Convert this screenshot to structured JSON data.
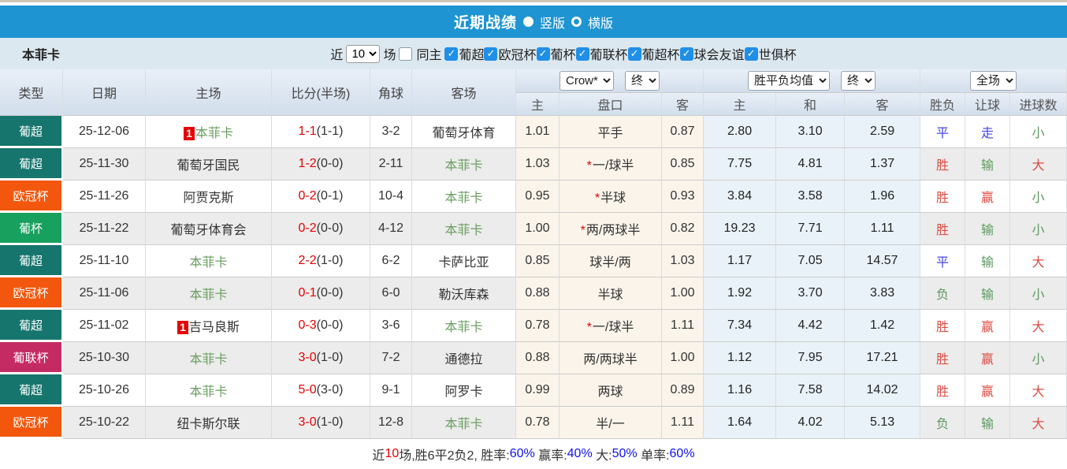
{
  "top_bar": {
    "title": "近期战绩",
    "view_options": [
      {
        "label": "竖版",
        "selected": true
      },
      {
        "label": "横版",
        "selected": false
      }
    ]
  },
  "filter": {
    "team_name": "本菲卡",
    "recent_label": "近",
    "recent_count": "10",
    "matches_label": "场",
    "same_home": {
      "label": "同主",
      "checked": false
    },
    "leagues": [
      {
        "label": "葡超",
        "checked": true
      },
      {
        "label": "欧冠杯",
        "checked": true
      },
      {
        "label": "葡杯",
        "checked": true
      },
      {
        "label": "葡联杯",
        "checked": true
      },
      {
        "label": "葡超杯",
        "checked": true
      },
      {
        "label": "球会友谊",
        "checked": true
      },
      {
        "label": "世俱杯",
        "checked": true
      }
    ]
  },
  "colors": {
    "top_bar_blue": "#1e94d2",
    "league": {
      "葡超": "#16756c",
      "欧冠杯": "#f2570d",
      "葡杯": "#17a05e",
      "葡联杯": "#c52b63"
    },
    "result_red": "#dd4b42",
    "result_green": "#5b9a5f",
    "result_blue": "#4444ee",
    "self_team_green": "#6b9f61",
    "score_red": "#e80000"
  },
  "table": {
    "headers": {
      "type": "类型",
      "date": "日期",
      "home": "主场",
      "score": "比分(半场)",
      "corner": "角球",
      "away": "客场"
    },
    "dropdowns": {
      "odds_source": "Crow*",
      "odds_time1": "终",
      "avg_type": "胜平负均值",
      "avg_time": "终",
      "scope": "全场"
    },
    "subheaders": {
      "h_home": "主",
      "h_line": "盘口",
      "h_away": "客",
      "e_home": "主",
      "e_draw": "和",
      "e_away": "客",
      "r_result": "胜负",
      "r_handicap": "让球",
      "r_goals": "进球数"
    },
    "rows": [
      {
        "league": "葡超",
        "date": "25-12-06",
        "home": {
          "name": "本菲卡",
          "self": true,
          "rank": "1"
        },
        "score": "1-1",
        "half": "(1-1)",
        "corner": "3-2",
        "away": {
          "name": "葡萄牙体育",
          "self": false
        },
        "handicap": {
          "home": "1.01",
          "star": false,
          "line": "平手",
          "away": "0.87"
        },
        "europe": {
          "win": "2.80",
          "draw": "3.10",
          "lose": "2.59"
        },
        "results": [
          {
            "text": "平",
            "color": "blue"
          },
          {
            "text": "走",
            "color": "blue"
          },
          {
            "text": "小",
            "color": "green"
          }
        ]
      },
      {
        "league": "葡超",
        "date": "25-11-30",
        "home": {
          "name": "葡萄牙国民",
          "self": false
        },
        "score": "1-2",
        "half": "(0-0)",
        "corner": "2-11",
        "away": {
          "name": "本菲卡",
          "self": true
        },
        "handicap": {
          "home": "1.03",
          "star": true,
          "line": "一/球半",
          "away": "0.85"
        },
        "europe": {
          "win": "7.75",
          "draw": "4.81",
          "lose": "1.37"
        },
        "results": [
          {
            "text": "胜",
            "color": "red"
          },
          {
            "text": "输",
            "color": "green"
          },
          {
            "text": "大",
            "color": "red"
          }
        ]
      },
      {
        "league": "欧冠杯",
        "date": "25-11-26",
        "home": {
          "name": "阿贾克斯",
          "self": false
        },
        "score": "0-2",
        "half": "(0-1)",
        "corner": "10-4",
        "away": {
          "name": "本菲卡",
          "self": true
        },
        "handicap": {
          "home": "0.95",
          "star": true,
          "line": "半球",
          "away": "0.93"
        },
        "europe": {
          "win": "3.84",
          "draw": "3.58",
          "lose": "1.96"
        },
        "results": [
          {
            "text": "胜",
            "color": "red"
          },
          {
            "text": "赢",
            "color": "red"
          },
          {
            "text": "小",
            "color": "green"
          }
        ]
      },
      {
        "league": "葡杯",
        "date": "25-11-22",
        "home": {
          "name": "葡萄牙体育会",
          "self": false
        },
        "score": "0-2",
        "half": "(0-0)",
        "corner": "4-12",
        "away": {
          "name": "本菲卡",
          "self": true
        },
        "handicap": {
          "home": "1.00",
          "star": true,
          "line": "两/两球半",
          "away": "0.82"
        },
        "europe": {
          "win": "19.23",
          "draw": "7.71",
          "lose": "1.11"
        },
        "results": [
          {
            "text": "胜",
            "color": "red"
          },
          {
            "text": "输",
            "color": "green"
          },
          {
            "text": "小",
            "color": "green"
          }
        ]
      },
      {
        "league": "葡超",
        "date": "25-11-10",
        "home": {
          "name": "本菲卡",
          "self": true
        },
        "score": "2-2",
        "half": "(1-0)",
        "corner": "6-2",
        "away": {
          "name": "卡萨比亚",
          "self": false
        },
        "handicap": {
          "home": "0.85",
          "star": false,
          "line": "球半/两",
          "away": "1.03"
        },
        "europe": {
          "win": "1.17",
          "draw": "7.05",
          "lose": "14.57"
        },
        "results": [
          {
            "text": "平",
            "color": "blue"
          },
          {
            "text": "输",
            "color": "green"
          },
          {
            "text": "大",
            "color": "red"
          }
        ]
      },
      {
        "league": "欧冠杯",
        "date": "25-11-06",
        "home": {
          "name": "本菲卡",
          "self": true
        },
        "score": "0-1",
        "half": "(0-0)",
        "corner": "6-0",
        "away": {
          "name": "勒沃库森",
          "self": false
        },
        "handicap": {
          "home": "0.88",
          "star": false,
          "line": "半球",
          "away": "1.00"
        },
        "europe": {
          "win": "1.92",
          "draw": "3.70",
          "lose": "3.83"
        },
        "results": [
          {
            "text": "负",
            "color": "green"
          },
          {
            "text": "输",
            "color": "green"
          },
          {
            "text": "小",
            "color": "green"
          }
        ]
      },
      {
        "league": "葡超",
        "date": "25-11-02",
        "home": {
          "name": "吉马良斯",
          "self": false,
          "rank": "1"
        },
        "score": "0-3",
        "half": "(0-0)",
        "corner": "3-6",
        "away": {
          "name": "本菲卡",
          "self": true
        },
        "handicap": {
          "home": "0.78",
          "star": true,
          "line": "一/球半",
          "away": "1.11"
        },
        "europe": {
          "win": "7.34",
          "draw": "4.42",
          "lose": "1.42"
        },
        "results": [
          {
            "text": "胜",
            "color": "red"
          },
          {
            "text": "赢",
            "color": "red"
          },
          {
            "text": "大",
            "color": "red"
          }
        ]
      },
      {
        "league": "葡联杯",
        "date": "25-10-30",
        "home": {
          "name": "本菲卡",
          "self": true
        },
        "score": "3-0",
        "half": "(1-0)",
        "corner": "7-2",
        "away": {
          "name": "通德拉",
          "self": false
        },
        "handicap": {
          "home": "0.88",
          "star": false,
          "line": "两/两球半",
          "away": "1.00"
        },
        "europe": {
          "win": "1.12",
          "draw": "7.95",
          "lose": "17.21"
        },
        "results": [
          {
            "text": "胜",
            "color": "red"
          },
          {
            "text": "赢",
            "color": "red"
          },
          {
            "text": "小",
            "color": "green"
          }
        ]
      },
      {
        "league": "葡超",
        "date": "25-10-26",
        "home": {
          "name": "本菲卡",
          "self": true
        },
        "score": "5-0",
        "half": "(3-0)",
        "corner": "9-1",
        "away": {
          "name": "阿罗卡",
          "self": false
        },
        "handicap": {
          "home": "0.99",
          "star": false,
          "line": "两球",
          "away": "0.89"
        },
        "europe": {
          "win": "1.16",
          "draw": "7.58",
          "lose": "14.02"
        },
        "results": [
          {
            "text": "胜",
            "color": "red"
          },
          {
            "text": "赢",
            "color": "red"
          },
          {
            "text": "大",
            "color": "red"
          }
        ]
      },
      {
        "league": "欧冠杯",
        "date": "25-10-22",
        "home": {
          "name": "纽卡斯尔联",
          "self": false
        },
        "score": "3-0",
        "half": "(1-0)",
        "corner": "12-8",
        "away": {
          "name": "本菲卡",
          "self": true
        },
        "handicap": {
          "home": "0.78",
          "star": false,
          "line": "半/一",
          "away": "1.11"
        },
        "europe": {
          "win": "1.64",
          "draw": "4.02",
          "lose": "5.13"
        },
        "results": [
          {
            "text": "负",
            "color": "green"
          },
          {
            "text": "输",
            "color": "green"
          },
          {
            "text": "大",
            "color": "red"
          }
        ]
      }
    ]
  },
  "footer": {
    "segments": [
      {
        "text": "近",
        "color": "dark"
      },
      {
        "text": "10",
        "color": "red"
      },
      {
        "text": "场,胜6平2负2, 胜率:",
        "color": "dark"
      },
      {
        "text": "60%",
        "color": "blue"
      },
      {
        "text": " 赢率:",
        "color": "dark"
      },
      {
        "text": "40%",
        "color": "blue"
      },
      {
        "text": " 大:",
        "color": "dark"
      },
      {
        "text": "50%",
        "color": "blue"
      },
      {
        "text": " 单率:",
        "color": "dark"
      },
      {
        "text": "60%",
        "color": "blue"
      }
    ]
  }
}
